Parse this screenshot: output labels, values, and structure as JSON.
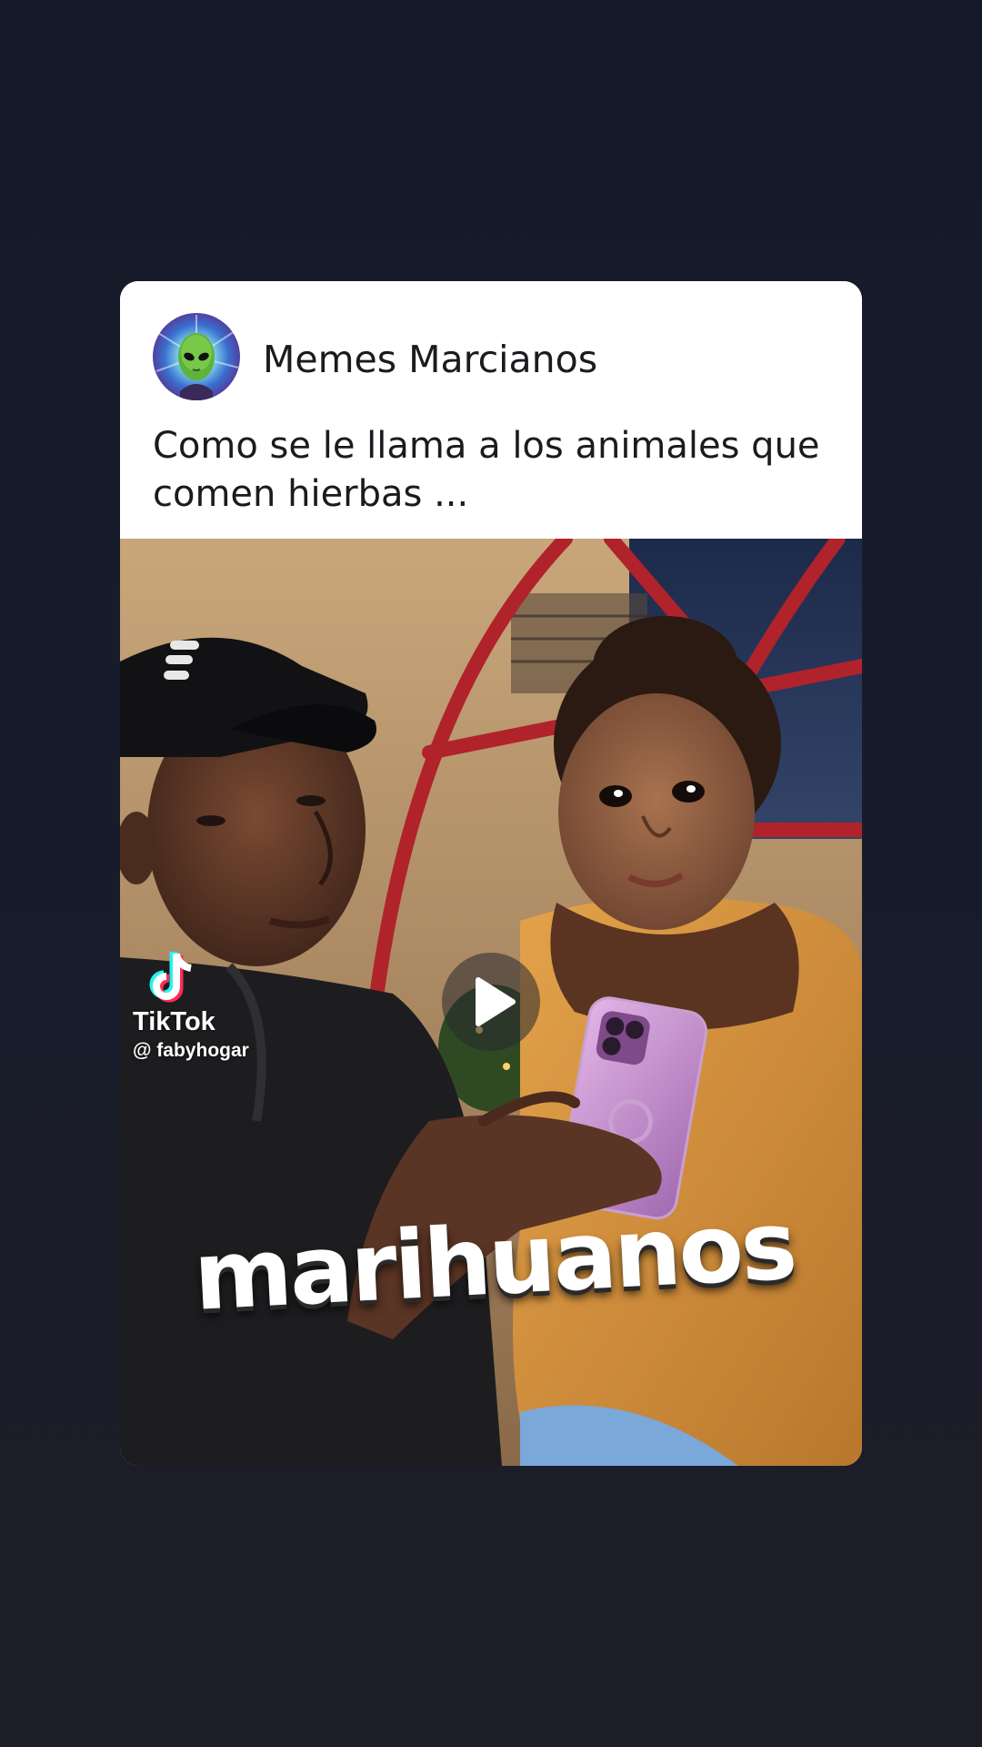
{
  "post": {
    "author": "Memes Marcianos",
    "caption": "Como se le llama a los animales que comen hierbas ...",
    "avatar_icon": "alien-icon"
  },
  "media": {
    "overlay_text": "marihuanos",
    "watermark": {
      "brand": "TikTok",
      "handle": "@ fabyhogar"
    },
    "play_icon": "play-icon"
  },
  "colors": {
    "background": "#181c2a",
    "card": "#ffffff",
    "text": "#1b1b1f"
  }
}
